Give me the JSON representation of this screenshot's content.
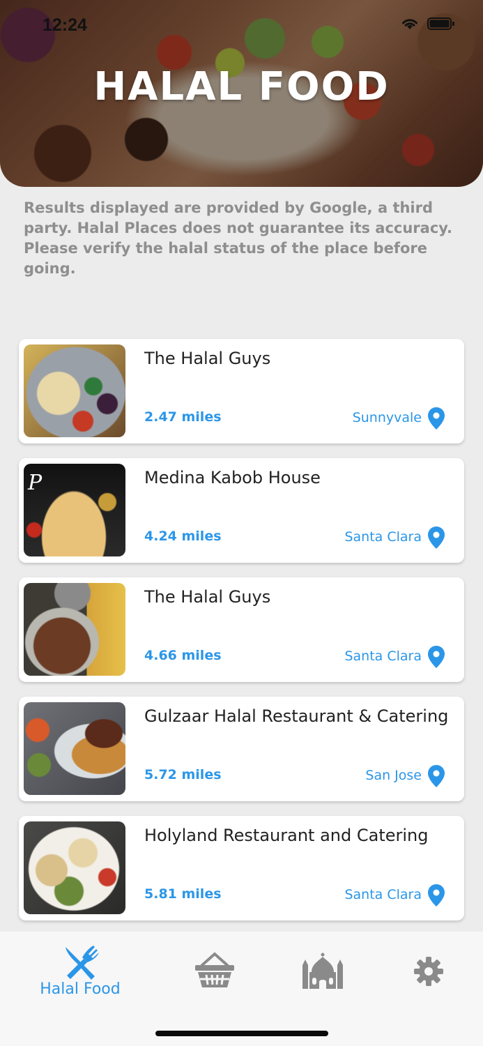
{
  "status_bar": {
    "time": "12:24"
  },
  "header": {
    "title": "HALAL FOOD"
  },
  "disclaimer": "Results displayed are provided by Google, a third party. Halal Places does not guarantee its accuracy. Please verify the halal status of the place before going.",
  "places": [
    {
      "name": "The Halal Guys",
      "distance": "2.47 miles",
      "city": "Sunnyvale"
    },
    {
      "name": "Medina Kabob House",
      "distance": "4.24 miles",
      "city": "Santa Clara"
    },
    {
      "name": "The Halal Guys",
      "distance": "4.66 miles",
      "city": "Santa Clara"
    },
    {
      "name": "Gulzaar Halal Restaurant & Catering",
      "distance": "5.72 miles",
      "city": "San Jose"
    },
    {
      "name": "Holyland Restaurant and Catering",
      "distance": "5.81 miles",
      "city": "Santa Clara"
    }
  ],
  "tabbar": {
    "active_label": "Halal Food",
    "tabs": [
      {
        "icon": "fork-knife-icon"
      },
      {
        "icon": "basket-icon"
      },
      {
        "icon": "mosque-icon"
      },
      {
        "icon": "gear-icon"
      }
    ]
  },
  "colors": {
    "accent": "#2b96e8",
    "inactive_icon": "#8a8a8a"
  }
}
